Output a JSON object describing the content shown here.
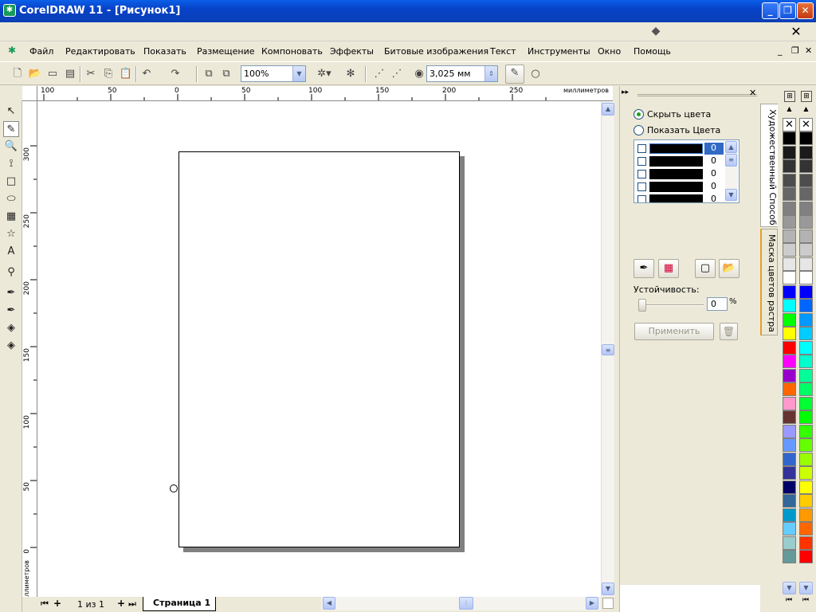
{
  "window": {
    "title": "CorelDRAW 11 - [Рисунок1]",
    "app_icon": "corel-icon",
    "minimize_label": "_",
    "maximize_label": "❐",
    "close_label": "✕"
  },
  "menu": [
    "Файл",
    "Редактировать",
    "Показать",
    "Размещение",
    "Компоновать",
    "Эффекты",
    "Битовые изображения",
    "Текст",
    "Инструменты",
    "Окно",
    "Помощь"
  ],
  "toolbar": {
    "zoom_value": "100%",
    "nudge_value": "3,025 мм"
  },
  "rulers": {
    "h_labels": [
      "100",
      "50",
      "0",
      "50",
      "100",
      "150",
      "200",
      "250"
    ],
    "unit": "миллиметров",
    "v_labels": [
      "300",
      "250",
      "200",
      "150",
      "100",
      "50",
      "0"
    ]
  },
  "page_nav": {
    "pages": "1 из 1",
    "tab": "Страница 1"
  },
  "docker": {
    "radio_hide": "Скрыть цвета",
    "radio_show": "Показать Цвета",
    "color_rows": [
      {
        "value": "0"
      },
      {
        "value": "0"
      },
      {
        "value": "0"
      },
      {
        "value": "0"
      },
      {
        "value": "0"
      }
    ],
    "tolerance_label": "Устойчивость:",
    "tolerance_value": "0",
    "percent": "%",
    "apply_label": "Применить",
    "tabs": [
      "Художественный Способ",
      "Маска цветов растра"
    ]
  },
  "palette_colors": [
    "#000000",
    "#1a1a1a",
    "#333333",
    "#4d4d4d",
    "#666666",
    "#808080",
    "#999999",
    "#b3b3b3",
    "#cccccc",
    "#e6e6e6",
    "#ffffff",
    "#0000ff",
    "#00ffff",
    "#00ff00",
    "#ffff00",
    "#ff0000",
    "#ff00ff",
    "#9900cc",
    "#ff6600",
    "#ff99cc",
    "#663333",
    "#9999ff",
    "#6699ff",
    "#3366cc",
    "#333399",
    "#000066",
    "#336699",
    "#0099cc",
    "#66ccff",
    "#99cccc",
    "#669999"
  ],
  "palette_colors_2": [
    "#000000",
    "#1a1a1a",
    "#333333",
    "#4d4d4d",
    "#666666",
    "#808080",
    "#999999",
    "#b3b3b3",
    "#cccccc",
    "#e6e6e6",
    "#ffffff",
    "#0000ff",
    "#0066ff",
    "#0099ff",
    "#00ccff",
    "#00ffff",
    "#00ffcc",
    "#00ff99",
    "#00ff66",
    "#00ff33",
    "#00ff00",
    "#33ff00",
    "#66ff00",
    "#99ff00",
    "#ccff00",
    "#ffff00",
    "#ffcc00",
    "#ff9900",
    "#ff6600",
    "#ff3300",
    "#ff0000"
  ]
}
